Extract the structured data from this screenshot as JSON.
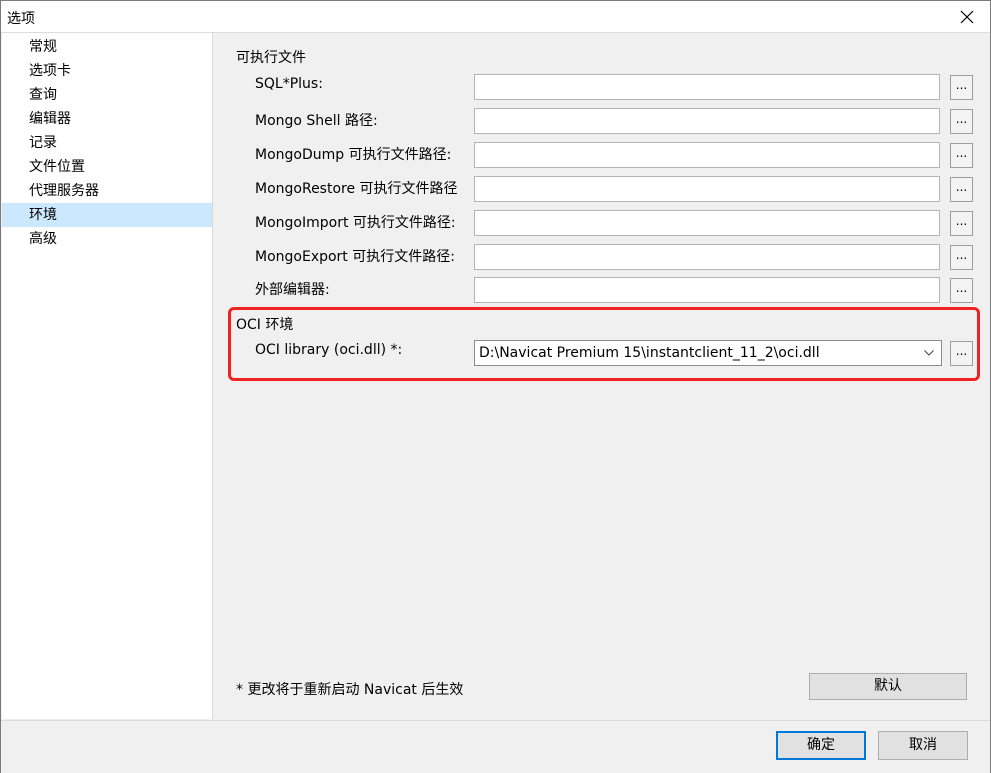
{
  "window": {
    "title": "选项",
    "close_icon": "close-icon"
  },
  "sidebar": {
    "items": [
      {
        "label": "常规"
      },
      {
        "label": "选项卡"
      },
      {
        "label": "查询"
      },
      {
        "label": "编辑器"
      },
      {
        "label": "记录"
      },
      {
        "label": "文件位置"
      },
      {
        "label": "代理服务器"
      },
      {
        "label": "环境",
        "selected": true
      },
      {
        "label": "高级"
      }
    ]
  },
  "executables": {
    "title": "可执行文件",
    "rows": [
      {
        "label": "SQL*Plus:",
        "value": ""
      },
      {
        "label": "Mongo Shell 路径:",
        "value": ""
      },
      {
        "label": "MongoDump 可执行文件路径:",
        "value": ""
      },
      {
        "label": "MongoRestore 可执行文件路径",
        "value": ""
      },
      {
        "label": "MongoImport 可执行文件路径:",
        "value": ""
      },
      {
        "label": "MongoExport 可执行文件路径:",
        "value": ""
      },
      {
        "label": "外部编辑器:",
        "value": ""
      }
    ],
    "browse_label": "..."
  },
  "oci": {
    "title": "OCI 环境",
    "library_label": "OCI library (oci.dll) *:",
    "library_value": "D:\\Navicat Premium 15\\instantclient_11_2\\oci.dll",
    "browse_label": "...",
    "highlight_color": "#ee2222"
  },
  "note": "* 更改将于重新启动 Navicat 后生效",
  "buttons": {
    "default": "默认",
    "ok": "确定",
    "cancel": "取消"
  },
  "colors": {
    "selection": "#cce8ff",
    "focus_border": "#0078d7"
  }
}
